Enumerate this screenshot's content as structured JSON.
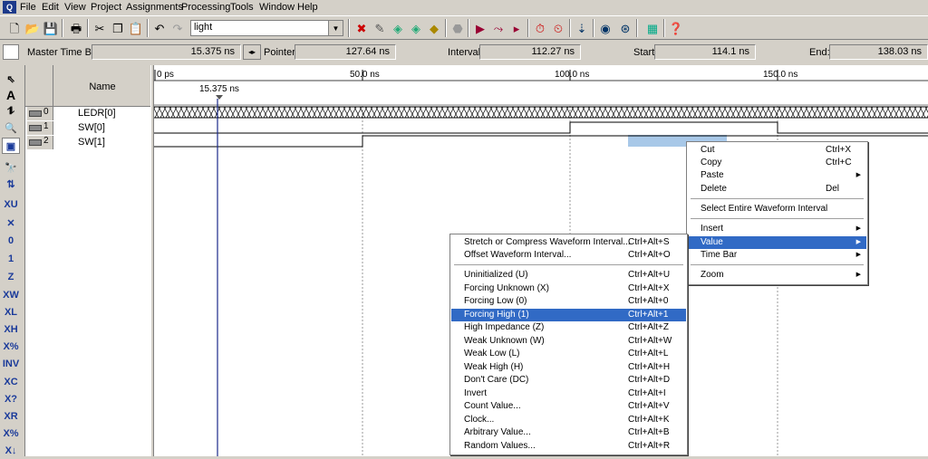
{
  "menubar": {
    "items": [
      "File",
      "Edit",
      "View",
      "Project",
      "Assignments",
      "Processing",
      "Tools",
      "Window",
      "Help"
    ]
  },
  "toolbar": {
    "combo_value": "light",
    "icons": [
      "new-file-icon",
      "open-icon",
      "save-icon",
      "print-icon",
      "cut-icon",
      "copy-icon",
      "paste-icon",
      "undo-icon",
      "redo-icon",
      "compilation-icon",
      "analysis-icon",
      "synthesis-icon",
      "fitter-icon",
      "stop-icon",
      "start-icon",
      "start-analysis-icon",
      "timing-icon",
      "timer-icon",
      "clock-icon",
      "programmer-icon",
      "chip-planner-icon",
      "netlist-icon",
      "rtl-icon",
      "report-icon",
      "help-icon"
    ]
  },
  "timebar": {
    "master_label": "Master Time Bar:",
    "master_value": "15.375 ns",
    "pointer_label": "Pointer:",
    "pointer_value": "127.64 ns",
    "interval_label": "Interval:",
    "interval_value": "112.27 ns",
    "start_label": "Start:",
    "start_value": "114.1 ns",
    "end_label": "End:",
    "end_value": "138.03 ns"
  },
  "signals": {
    "header": "Name",
    "rows": [
      {
        "index": "0",
        "name": "LEDR[0]"
      },
      {
        "index": "1",
        "name": "SW[0]"
      },
      {
        "index": "2",
        "name": "SW[1]"
      }
    ]
  },
  "waveform": {
    "ticks": [
      "0 ps",
      "50.0 ns",
      "100.0 ns",
      "150.0 ns"
    ],
    "cursor_label": "15.375 ns"
  },
  "context_menu": {
    "items": [
      {
        "label": "Cut",
        "shortcut": "Ctrl+X"
      },
      {
        "label": "Copy",
        "shortcut": "Ctrl+C"
      },
      {
        "label": "Paste",
        "shortcut": ""
      },
      {
        "label": "Delete",
        "shortcut": "Del"
      },
      {
        "label": "Select Entire Waveform Interval",
        "shortcut": ""
      },
      {
        "label": "Insert",
        "shortcut": ""
      },
      {
        "label": "Value",
        "shortcut": ""
      },
      {
        "label": "Time Bar",
        "shortcut": ""
      },
      {
        "label": "Zoom",
        "shortcut": ""
      }
    ]
  },
  "value_submenu": {
    "items": [
      {
        "label": "Stretch or Compress Waveform Interval...",
        "shortcut": "Ctrl+Alt+S"
      },
      {
        "label": "Offset Waveform Interval...",
        "shortcut": "Ctrl+Alt+O"
      },
      {
        "label": "Uninitialized (U)",
        "shortcut": "Ctrl+Alt+U"
      },
      {
        "label": "Forcing Unknown (X)",
        "shortcut": "Ctrl+Alt+X"
      },
      {
        "label": "Forcing Low (0)",
        "shortcut": "Ctrl+Alt+0"
      },
      {
        "label": "Forcing High (1)",
        "shortcut": "Ctrl+Alt+1"
      },
      {
        "label": "High Impedance (Z)",
        "shortcut": "Ctrl+Alt+Z"
      },
      {
        "label": "Weak Unknown (W)",
        "shortcut": "Ctrl+Alt+W"
      },
      {
        "label": "Weak Low (L)",
        "shortcut": "Ctrl+Alt+L"
      },
      {
        "label": "Weak High (H)",
        "shortcut": "Ctrl+Alt+H"
      },
      {
        "label": "Don't Care (DC)",
        "shortcut": "Ctrl+Alt+D"
      },
      {
        "label": "Invert",
        "shortcut": "Ctrl+Alt+I"
      },
      {
        "label": "Count Value...",
        "shortcut": "Ctrl+Alt+V"
      },
      {
        "label": "Clock...",
        "shortcut": "Ctrl+Alt+K"
      },
      {
        "label": "Arbitrary Value...",
        "shortcut": "Ctrl+Alt+B"
      },
      {
        "label": "Random Values...",
        "shortcut": "Ctrl+Alt+R"
      }
    ]
  }
}
